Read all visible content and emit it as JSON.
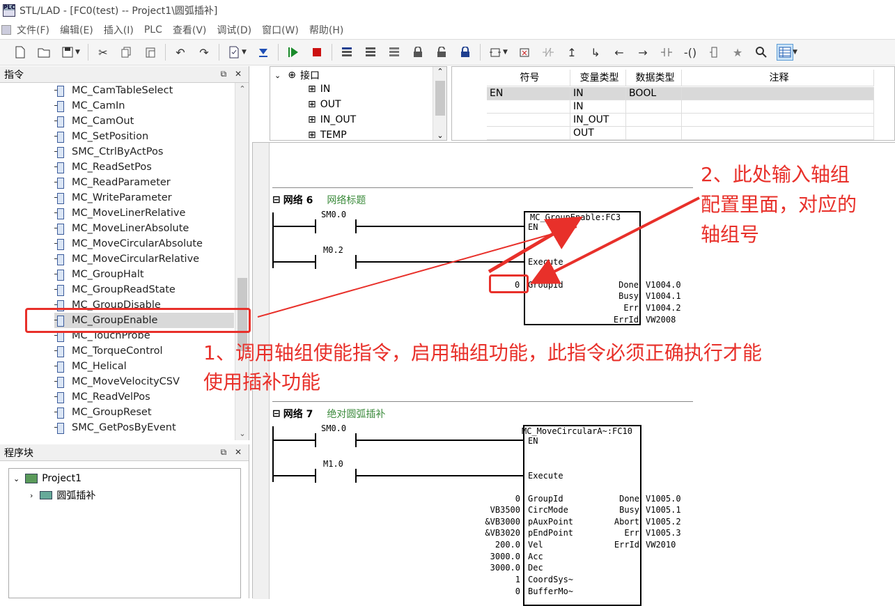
{
  "window": {
    "title": "STL/LAD - [FC0(test) -- Project1\\圆弧插补]",
    "app_icon": "plc-app-icon"
  },
  "menu": [
    "文件(F)",
    "编辑(E)",
    "插入(I)",
    "PLC",
    "查看(V)",
    "调试(D)",
    "窗口(W)",
    "帮助(H)"
  ],
  "toolbar": {
    "icons": [
      "new-icon",
      "open-icon",
      "save-icon",
      "cut-icon",
      "copy-icon",
      "paste-icon",
      "undo-icon",
      "redo-icon",
      "compile-icon",
      "download-icon",
      "run-icon",
      "stop-icon",
      "network-insert-icon",
      "network-delete-icon",
      "network-icon",
      "lock-icon",
      "unlock-icon",
      "protect-icon",
      "insert-box-icon",
      "delete-box-icon",
      "negate-icon",
      "rising-edge-icon",
      "falling-edge-icon",
      "wire-left-icon",
      "wire-right-icon",
      "contact-icon",
      "coil-icon",
      "box-icon",
      "bookmark-icon",
      "zoom-icon",
      "table-view-icon"
    ]
  },
  "instructions_panel": {
    "title": "指令",
    "items": [
      "MC_CamTableSelect",
      "MC_CamIn",
      "MC_CamOut",
      "MC_SetPosition",
      "SMC_CtrlByActPos",
      "MC_ReadSetPos",
      "MC_ReadParameter",
      "MC_WriteParameter",
      "MC_MoveLinerRelative",
      "MC_MoveLinerAbsolute",
      "MC_MoveCircularAbsolute",
      "MC_MoveCircularRelative",
      "MC_GroupHalt",
      "MC_GroupReadState",
      "MC_GroupDisable",
      "MC_GroupEnable",
      "MC_TouchProbe",
      "MC_TorqueControl",
      "MC_Helical",
      "MC_MoveVelocityCSV",
      "MC_ReadVelPos",
      "MC_GroupReset",
      "SMC_GetPosByEvent"
    ],
    "selected": "MC_GroupEnable"
  },
  "program_panel": {
    "title": "程序块",
    "project": "Project1",
    "child": "圆弧插补"
  },
  "interface": {
    "root": "接口",
    "items": [
      "IN",
      "OUT",
      "IN_OUT",
      "TEMP"
    ]
  },
  "var_table": {
    "headers": [
      "符号",
      "变量类型",
      "数据类型",
      "注释"
    ],
    "rows": [
      {
        "symbol": "EN",
        "vtype": "IN",
        "dtype": "BOOL",
        "comment": ""
      },
      {
        "symbol": "",
        "vtype": "IN",
        "dtype": "",
        "comment": ""
      },
      {
        "symbol": "",
        "vtype": "IN_OUT",
        "dtype": "",
        "comment": ""
      },
      {
        "symbol": "",
        "vtype": "OUT",
        "dtype": "",
        "comment": ""
      }
    ]
  },
  "network6": {
    "label": "网络 6",
    "comment": "网络标题",
    "contact1": "SM0.0",
    "contact2": "M0.2",
    "block": "MC_GroupEnable:FC3",
    "en": "EN",
    "execute": "Execute",
    "groupid_val": "0",
    "groupid": "GroupId",
    "outputs": [
      {
        "pin": "Done",
        "val": "V1004.0"
      },
      {
        "pin": "Busy",
        "val": "V1004.1"
      },
      {
        "pin": "Err",
        "val": "V1004.2"
      },
      {
        "pin": "ErrId",
        "val": "VW2008"
      }
    ]
  },
  "network7": {
    "label": "网络 7",
    "comment": "绝对圆弧插补",
    "contact1": "SM0.0",
    "contact2": "M1.0",
    "block": "MC_MoveCircularA~:FC10",
    "en": "EN",
    "execute": "Execute",
    "inputs": [
      {
        "val": "0",
        "pin": "GroupId"
      },
      {
        "val": "VB3500",
        "pin": "CircMode"
      },
      {
        "val": "&VB3000",
        "pin": "pAuxPoint"
      },
      {
        "val": "&VB3020",
        "pin": "pEndPoint"
      },
      {
        "val": "200.0",
        "pin": "Vel"
      },
      {
        "val": "3000.0",
        "pin": "Acc"
      },
      {
        "val": "3000.0",
        "pin": "Dec"
      },
      {
        "val": "1",
        "pin": "CoordSys~"
      },
      {
        "val": "0",
        "pin": "BufferMo~"
      }
    ],
    "outputs": [
      {
        "pin": "Done",
        "val": "V1005.0"
      },
      {
        "pin": "Busy",
        "val": "V1005.1"
      },
      {
        "pin": "Abort",
        "val": "V1005.2"
      },
      {
        "pin": "Err",
        "val": "V1005.3"
      },
      {
        "pin": "ErrId",
        "val": "VW2010"
      }
    ]
  },
  "annotations": {
    "note1_line1": "1、调用轴组使能指令，启用轴组功能，此指令必须正确执行才能",
    "note1_line2": "使用插补功能",
    "note2_line1": "2、此处输入轴组",
    "note2_line2": "配置里面，对应的",
    "note2_line3": "轴组号"
  },
  "colors": {
    "annotation": "#e8302a",
    "selection": "#d9d9d9",
    "comment_green": "#3a8a3a"
  }
}
